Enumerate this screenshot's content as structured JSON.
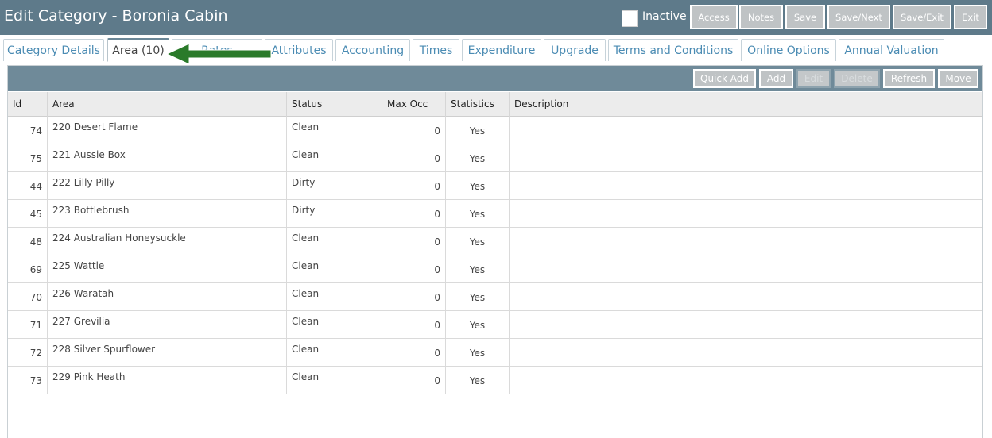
{
  "header": {
    "title": "Edit Category - Boronia Cabin",
    "inactive_label": "Inactive",
    "buttons": [
      "Access",
      "Notes",
      "Save",
      "Save/Next",
      "Save/Exit",
      "Exit"
    ]
  },
  "tabs": [
    {
      "label": "Category Details",
      "active": false
    },
    {
      "label": "Area (10)",
      "active": true
    },
    {
      "label": "Rates",
      "active": false
    },
    {
      "label": "Attributes",
      "active": false
    },
    {
      "label": "Accounting",
      "active": false
    },
    {
      "label": "Times",
      "active": false
    },
    {
      "label": "Expenditure",
      "active": false
    },
    {
      "label": "Upgrade",
      "active": false
    },
    {
      "label": "Terms and Conditions",
      "active": false
    },
    {
      "label": "Online Options",
      "active": false
    },
    {
      "label": "Annual Valuation",
      "active": false
    }
  ],
  "grid": {
    "toolbar_buttons": [
      {
        "label": "Quick Add",
        "enabled": true
      },
      {
        "label": "Add",
        "enabled": true
      },
      {
        "label": "Edit",
        "enabled": false
      },
      {
        "label": "Delete",
        "enabled": false
      },
      {
        "label": "Refresh",
        "enabled": true
      },
      {
        "label": "Move",
        "enabled": true
      }
    ],
    "columns": [
      "Id",
      "Area",
      "Status",
      "Max Occ",
      "Statistics",
      "Description"
    ],
    "rows": [
      {
        "id": "74",
        "area": "220 Desert Flame",
        "status": "Clean",
        "max_occ": "0",
        "statistics": "Yes",
        "description": ""
      },
      {
        "id": "75",
        "area": "221 Aussie Box",
        "status": "Clean",
        "max_occ": "0",
        "statistics": "Yes",
        "description": ""
      },
      {
        "id": "44",
        "area": "222 Lilly Pilly",
        "status": "Dirty",
        "max_occ": "0",
        "statistics": "Yes",
        "description": ""
      },
      {
        "id": "45",
        "area": "223 Bottlebrush",
        "status": "Dirty",
        "max_occ": "0",
        "statistics": "Yes",
        "description": ""
      },
      {
        "id": "48",
        "area": "224 Australian Honeysuckle",
        "status": "Clean",
        "max_occ": "0",
        "statistics": "Yes",
        "description": ""
      },
      {
        "id": "69",
        "area": "225 Wattle",
        "status": "Clean",
        "max_occ": "0",
        "statistics": "Yes",
        "description": ""
      },
      {
        "id": "70",
        "area": "226 Waratah",
        "status": "Clean",
        "max_occ": "0",
        "statistics": "Yes",
        "description": ""
      },
      {
        "id": "71",
        "area": "227 Grevilia",
        "status": "Clean",
        "max_occ": "0",
        "statistics": "Yes",
        "description": ""
      },
      {
        "id": "72",
        "area": "228 Silver Spurflower",
        "status": "Clean",
        "max_occ": "0",
        "statistics": "Yes",
        "description": ""
      },
      {
        "id": "73",
        "area": "229 Pink Heath",
        "status": "Clean",
        "max_occ": "0",
        "statistics": "Yes",
        "description": ""
      }
    ]
  },
  "colors": {
    "titlebar": "#5e7a8a",
    "toolbar": "#6f8a99",
    "tab_text": "#4a8bb3",
    "button_bg": "#bfc3c5",
    "arrow": "#2a7a2a"
  },
  "annotation_icon": "green-arrow-icon"
}
